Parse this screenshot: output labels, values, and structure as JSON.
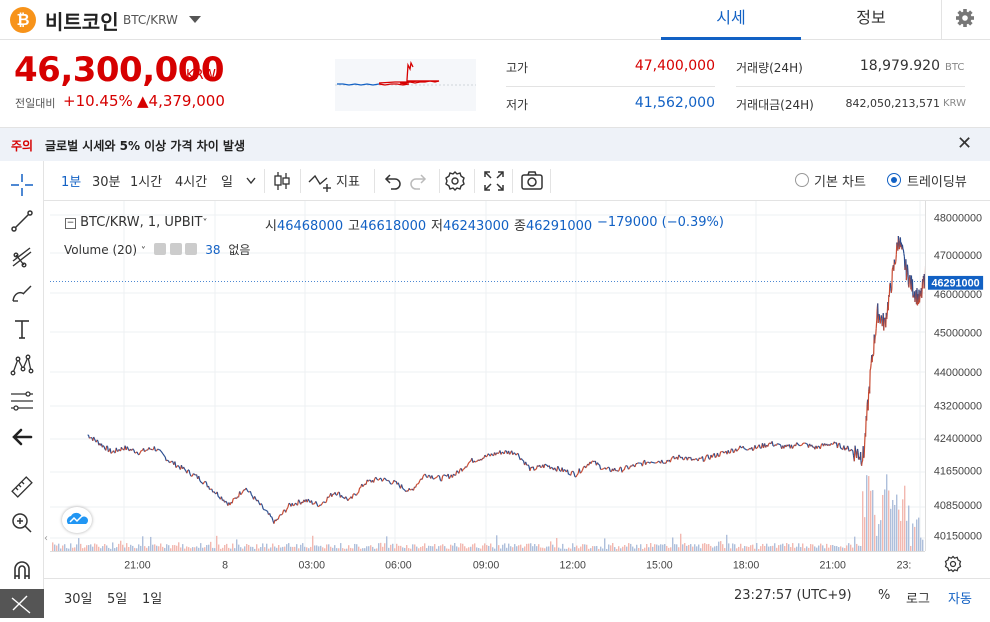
{
  "header": {
    "coin_icon_glyph": "₿",
    "coin_name": "비트코인",
    "pair": "BTC/KRW",
    "tabs": [
      {
        "label": "시세"
      },
      {
        "label": "정보"
      }
    ],
    "settings_icon": "gear-icon"
  },
  "price": {
    "current": "46,300,000",
    "unit": "KRW",
    "prev_label": "전일대비",
    "change_pct": "+10.45%",
    "change_amount": "▲4,379,000"
  },
  "stats": {
    "high_label": "고가",
    "high": "47,400,000",
    "low_label": "저가",
    "low": "41,562,000",
    "volume_label": "거래량(24H)",
    "volume": "18,979.920",
    "volume_unit": "BTC",
    "amount_label": "거래대금(24H)",
    "amount": "842,050,213,571",
    "amount_unit": "KRW"
  },
  "notice": {
    "tag": "주의",
    "text": "글로벌 시세와 5% 이상 가격 차이 발생"
  },
  "toolbar": {
    "intervals": [
      "1분",
      "30분",
      "1시간",
      "4시간",
      "일"
    ],
    "indicator_label": "지표",
    "chart_mode_basic": "기본 차트",
    "chart_mode_tv": "트레이딩뷰"
  },
  "legend": {
    "title": "BTC/KRW, 1, UPBIT",
    "open_k": "시",
    "open": "46468000",
    "high_k": "고",
    "high": "46618000",
    "low_k": "저",
    "low": "46243000",
    "close_k": "종",
    "close": "46291000",
    "change": "−179000 (−0.39%)",
    "volume_title": "Volume (20)",
    "volume_value": "38",
    "volume_none": "없음"
  },
  "chart_data": {
    "type": "line",
    "title": "",
    "xlabel": "",
    "ylabel": "",
    "x_ticks": [
      "21:00",
      "8",
      "03:00",
      "06:00",
      "09:00",
      "12:00",
      "15:00",
      "18:00",
      "21:00",
      "23:"
    ],
    "y_ticks": [
      "48000000",
      "47000000",
      "46000000",
      "45000000",
      "44000000",
      "43200000",
      "42400000",
      "41650000",
      "40850000",
      "40150000"
    ],
    "current_price_label": "46291000",
    "ylim": [
      40000000,
      48000000
    ],
    "x_hours": [
      19.8,
      20.2,
      20.6,
      21.0,
      21.5,
      22.0,
      22.5,
      23.0,
      23.5,
      24.0,
      24.5,
      25.0,
      25.5,
      26.0,
      26.5,
      27.0,
      27.5,
      28.0,
      28.5,
      29.0,
      29.5,
      30.0,
      30.5,
      31.0,
      31.5,
      32.0,
      32.5,
      33.0,
      33.5,
      34.0,
      34.5,
      35.0,
      35.5,
      36.0,
      36.5,
      37.0,
      37.5,
      38.0,
      38.5,
      39.0,
      39.5,
      40.0,
      40.5,
      41.0,
      41.5,
      42.0,
      42.5,
      43.0,
      43.5,
      44.0,
      44.5,
      45.0,
      45.3,
      45.5,
      45.7,
      45.9,
      46.1,
      46.3,
      46.5,
      46.7,
      46.9,
      47.1,
      47.3,
      47.5
    ],
    "values": [
      42500000,
      42300000,
      42100000,
      42200000,
      42100000,
      42200000,
      41900000,
      41700000,
      41500000,
      41200000,
      40900000,
      41300000,
      40900000,
      40500000,
      40900000,
      41000000,
      40900000,
      41200000,
      41000000,
      41400000,
      41500000,
      41400000,
      41200000,
      41600000,
      41500000,
      41600000,
      41900000,
      42000000,
      42100000,
      42100000,
      41700000,
      41800000,
      41700000,
      41600000,
      41900000,
      41700000,
      41700000,
      41800000,
      41900000,
      41900000,
      42000000,
      41900000,
      42000000,
      42100000,
      42200000,
      42200000,
      42300000,
      42200000,
      42300000,
      42200000,
      42300000,
      42200000,
      42100000,
      42000000,
      44000000,
      45500000,
      45200000,
      46300000,
      47400000,
      46600000,
      46100000,
      45800000,
      46500000,
      46300000
    ],
    "volume_hint": "spike near 21:00-23:00 on the second day"
  },
  "bottom": {
    "ranges": [
      "30일",
      "5일",
      "1일"
    ],
    "clock": "23:27:57 (UTC+9)",
    "pct": "%",
    "log": "로그",
    "auto": "자동"
  }
}
